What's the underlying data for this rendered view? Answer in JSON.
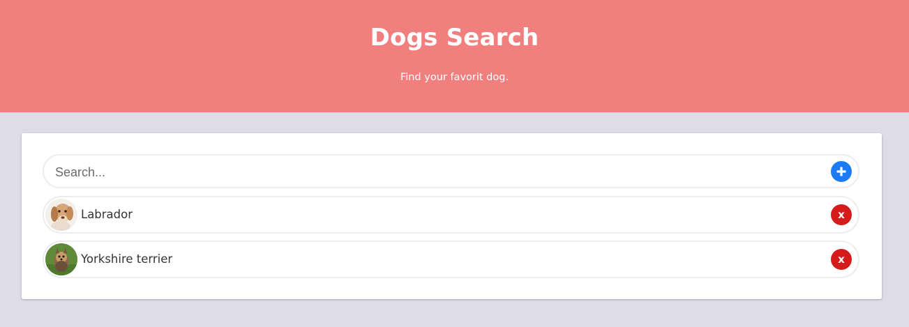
{
  "header": {
    "title": "Dogs Search",
    "subtitle": "Find your favorit dog.",
    "background_color": "#f07f7e"
  },
  "search": {
    "placeholder": "Search...",
    "value": "",
    "add_icon": "plus-icon",
    "add_color": "#1a7bf5"
  },
  "dogs": [
    {
      "name": "Labrador",
      "avatar": "labrador-photo",
      "remove_label": "x"
    },
    {
      "name": "Yorkshire terrier",
      "avatar": "yorkshire-terrier-photo",
      "remove_label": "x"
    }
  ],
  "colors": {
    "page_background": "#dedde5",
    "remove": "#d41a1a"
  }
}
